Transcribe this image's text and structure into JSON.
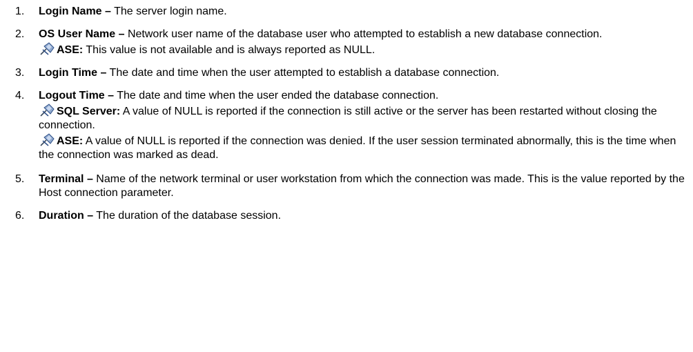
{
  "items": [
    {
      "number": "1.",
      "term": "Login Name –",
      "text": " The server login name."
    },
    {
      "number": "2.",
      "term": "OS User Name –",
      "text": " Network user name of the database user who attempted to establish a new database connection.",
      "notes": [
        {
          "label": "ASE:",
          "text": " This value is not available and is always reported as NULL."
        }
      ]
    },
    {
      "number": "3.",
      "term": "Login Time –",
      "text": " The date and time when the user attempted to establish a database connection."
    },
    {
      "number": "4.",
      "term": "Logout Time –",
      "text": " The date and time when the user ended the database connection.",
      "notes": [
        {
          "label": "SQL Server:",
          "text": "  A value of NULL is reported if the connection is still active or the server has been restarted without closing the connection."
        },
        {
          "label": "ASE:",
          "text": " A value of NULL is reported if the connection was denied. If the user session terminated abnormally, this is the time when the connection was marked as dead."
        }
      ]
    },
    {
      "number": "5.",
      "term": "Terminal –",
      "text": " Name of the network terminal or user workstation from which the connection was made. This is the value reported by the Host connection parameter."
    },
    {
      "number": "6.",
      "term": "Duration –",
      "text": " The duration of the database session."
    }
  ],
  "icons": {
    "note": "pushpin-icon"
  }
}
